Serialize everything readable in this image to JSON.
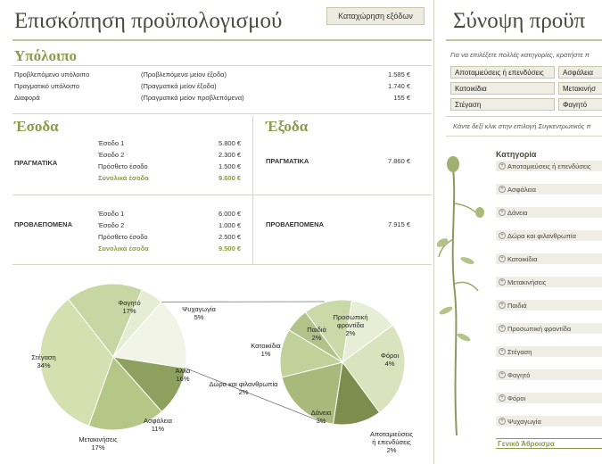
{
  "left": {
    "title": "Επισκόπηση προϋπολογισμού",
    "enter_expenses_button": "Καταχώρηση εξόδων",
    "balance": {
      "heading": "Υπόλοιπο",
      "rows": [
        {
          "label": "Προβλεπόμενο υπόλοιπο",
          "formula": "(Προβλεπόμενα μείον έξοδα)",
          "value": "1.585 €"
        },
        {
          "label": "Πραγματικό υπόλοιπο",
          "formula": "(Πραγματικά μείον έξοδα)",
          "value": "1.740 €"
        },
        {
          "label": "Διαφορά",
          "formula": "(Πραγματικά μείον προβλεπόμενα)",
          "value": "155 €"
        }
      ]
    },
    "income": {
      "heading": "Έσοδα",
      "actual": {
        "label": "ΠΡΑΓΜΑΤΙΚΑ",
        "rows": [
          {
            "label": "Έσοδο 1",
            "value": "5.800 €"
          },
          {
            "label": "Έσοδο 2",
            "value": "2.300 €"
          },
          {
            "label": "Πρόσθετο έσοδο",
            "value": "1.500 €"
          }
        ],
        "total_label": "Συνολικά έσοδα",
        "total_value": "9.600 €"
      },
      "projected": {
        "label": "ΠΡΟΒΛΕΠΟΜΕΝΑ",
        "rows": [
          {
            "label": "Έσοδο 1",
            "value": "6.000 €"
          },
          {
            "label": "Έσοδο 2",
            "value": "1.000 €"
          },
          {
            "label": "Πρόσθετο έσοδο",
            "value": "2.500 €"
          }
        ],
        "total_label": "Συνολικά έσοδα",
        "total_value": "9.500 €"
      }
    },
    "expenses": {
      "heading": "Έξοδα",
      "actual": {
        "label": "ΠΡΑΓΜΑΤΙΚΑ",
        "value": "7.860 €"
      },
      "projected": {
        "label": "ΠΡΟΒΛΕΠΟΜΕΝΑ",
        "value": "7.915 €"
      }
    }
  },
  "chart_data": {
    "type": "pie",
    "title": "",
    "main_pie": [
      {
        "label": "Φαγητό",
        "value": 17
      },
      {
        "label": "Ψυχαγωγία",
        "value": 5
      },
      {
        "label": "Άλλα",
        "value": 16
      },
      {
        "label": "Ασφάλεια",
        "value": 11
      },
      {
        "label": "Μετακινήσεις",
        "value": 17
      },
      {
        "label": "Στέγαση",
        "value": 34
      }
    ],
    "secondary_pie": [
      {
        "label": "Προσωπική φροντίδα",
        "value": 2
      },
      {
        "label": "Φόροι",
        "value": 4
      },
      {
        "label": "Αποταμιεύσεις ή επενδύσεις",
        "value": 2
      },
      {
        "label": "Δάνεια",
        "value": 3
      },
      {
        "label": "Δώρα και φιλανθρωπία",
        "value": 2
      },
      {
        "label": "Κατοικίδια",
        "value": 1
      },
      {
        "label": "Παιδιά",
        "value": 2
      }
    ],
    "colors": {
      "Φαγητό": "#c7d6a2",
      "Ψυχαγωγία": "#e6ecd3",
      "Άλλα": "#f1f4e6",
      "Ασφάλεια": "#8ea05e",
      "Μετακινήσεις": "#b5c786",
      "Στέγαση": "#d4e0b0",
      "Προσωπική φροντίδα": "#e8eed5",
      "Φόροι": "#d9e3bd",
      "Αποταμιεύσεις ή επενδύσεις": "#7d8d4e",
      "Δάνεια": "#a9b97c",
      "Δώρα και φιλανθρωπία": "#c2d09a",
      "Κατοικίδια": "#b2c288",
      "Παιδιά": "#cbd8a8"
    }
  },
  "right": {
    "title": "Σύνοψη προϋπ",
    "hint": "Για να επιλέξετε πολλές κατηγορίες, κρατήστε π",
    "slicers": [
      "Αποταμιεύσεις ή επενδύσεις",
      "Ασφάλεια",
      "Κατοικίδια",
      "Μετακινήσ",
      "Στέγαση",
      "Φαγητό"
    ],
    "pivot_hint": "Κάντε δεξί κλικ στην επιλογή Συγκεντρωτικός π",
    "category_header": "Κατηγορία",
    "categories": [
      "Αποταμιεύσεις ή επενδύσεις",
      "Ασφάλεια",
      "Δάνεια",
      "Δώρα και φιλανθρωπία",
      "Κατοικίδια",
      "Μετακινήσεις",
      "Παιδιά",
      "Προσωπική φροντίδα",
      "Στέγαση",
      "Φαγητό",
      "Φόροι",
      "Ψυχαγωγία"
    ],
    "grand_total": "Γενικό Άθροισμα"
  }
}
